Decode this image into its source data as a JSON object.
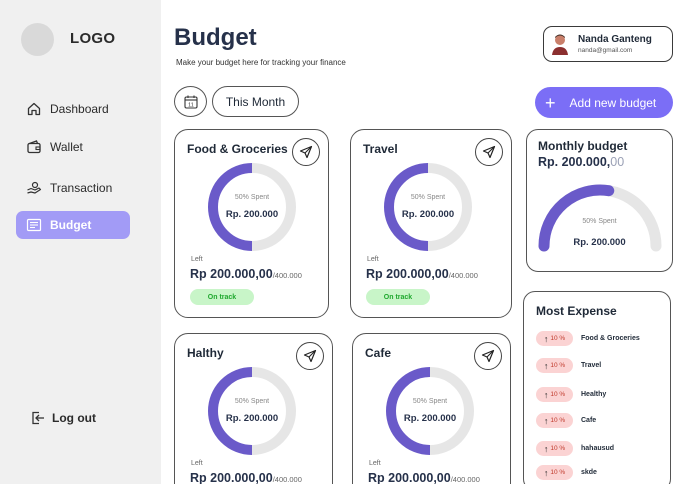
{
  "sidebar": {
    "logo": "LOGO",
    "items": [
      {
        "label": "Dashboard",
        "icon": "home-icon"
      },
      {
        "label": "Wallet",
        "icon": "wallet-icon"
      },
      {
        "label": "Transaction",
        "icon": "hand-coin-icon"
      },
      {
        "label": "Budget",
        "icon": "budget-icon",
        "active": true
      }
    ],
    "logout": "Log out"
  },
  "header": {
    "title": "Budget",
    "subtitle": "Make your budget here for tracking your finance"
  },
  "profile": {
    "name": "Nanda Ganteng",
    "email": "nanda@gmail.com"
  },
  "toolbar": {
    "calendar_day": "11",
    "period": "This Month",
    "add_label": "Add new budget"
  },
  "colors": {
    "accent": "#7b6ef6",
    "ring": "#6a5ac9",
    "track": "#e6e6e6",
    "ok_bg": "#c8f5c8",
    "ok_text": "#1fa82e",
    "expense_badge": "#fbd3d3"
  },
  "categories": [
    {
      "name": "Food & Groceries",
      "spent_label": "50% Spent",
      "spent_fraction": 0.5,
      "amount": "Rp. 200.000",
      "left_label": "Left",
      "left_amount": "Rp 200.000,00",
      "left_total": "/400.000",
      "status": "On track"
    },
    {
      "name": "Travel",
      "spent_label": "50% Spent",
      "spent_fraction": 0.5,
      "amount": "Rp. 200.000",
      "left_label": "Left",
      "left_amount": "Rp 200.000,00",
      "left_total": "/400.000",
      "status": "On track"
    },
    {
      "name": "Halthy",
      "spent_label": "50% Spent",
      "spent_fraction": 0.5,
      "amount": "Rp. 200.000",
      "left_label": "Left",
      "left_amount": "Rp 200.000,00",
      "left_total": "/400.000"
    },
    {
      "name": "Cafe",
      "spent_label": "50% Spent",
      "spent_fraction": 0.5,
      "amount": "Rp. 200.000",
      "left_label": "Left",
      "left_amount": "Rp 200.000,00",
      "left_total": "/400.000"
    }
  ],
  "monthly": {
    "title": "Monthly budget",
    "amount": "Rp. 200.000,",
    "amount_cents": "00",
    "spent_label": "50% Spent",
    "spent_fraction": 0.5,
    "value": "Rp. 200.000"
  },
  "expense": {
    "title": "Most Expense",
    "items": [
      {
        "percent": "10 %",
        "label": "Food & Groceries"
      },
      {
        "percent": "10 %",
        "label": "Travel"
      },
      {
        "percent": "10 %",
        "label": "Healthy"
      },
      {
        "percent": "10 %",
        "label": "Cafe"
      },
      {
        "percent": "10 %",
        "label": "hahausud"
      },
      {
        "percent": "10 %",
        "label": "skde"
      }
    ]
  }
}
